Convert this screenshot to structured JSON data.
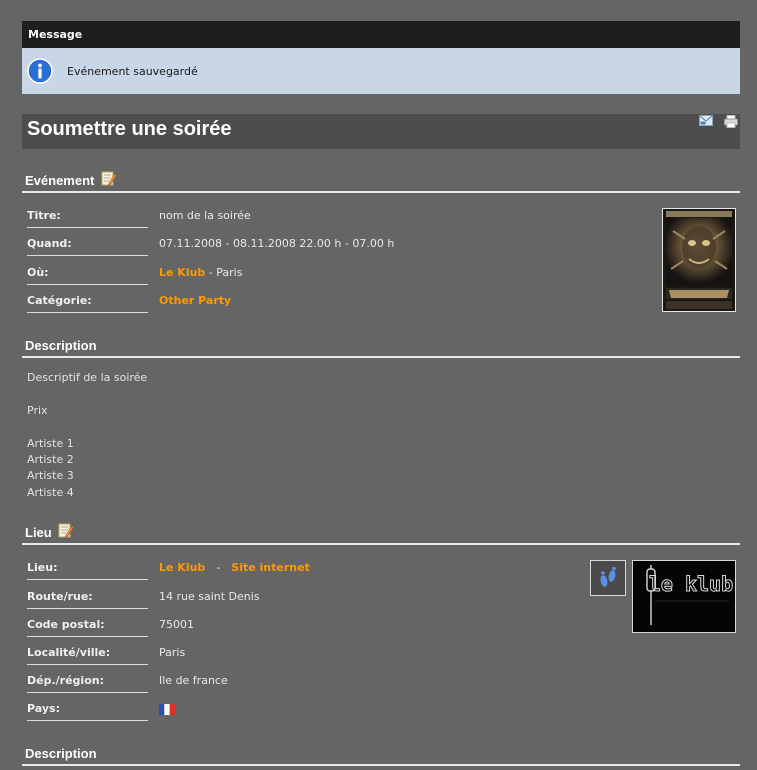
{
  "message": {
    "header": "Message",
    "text": "Evénement sauvegardé"
  },
  "page": {
    "title": "Soumettre une soirée"
  },
  "event": {
    "section": "Evénement",
    "fields": [
      {
        "label": "Titre:",
        "value": "nom de la soirée"
      },
      {
        "label": "Quand:",
        "value": "07.11.2008 - 08.11.2008 22.00 h - 07.00 h"
      },
      {
        "label": "Où:",
        "link": "Le Klub",
        "suffix": " - Paris"
      },
      {
        "label": "Catégorie:",
        "link": "Other Party"
      }
    ]
  },
  "description": {
    "section": "Description",
    "lines": [
      "Descriptif de la soirée",
      "",
      "Prix",
      "",
      "Artiste 1",
      "Artiste 2",
      "Artiste 3",
      "Artiste 4"
    ]
  },
  "venue": {
    "section": "Lieu",
    "fields": [
      {
        "label": "Lieu:",
        "link": "Le Klub",
        "separator": "-",
        "link2": "Site internet"
      },
      {
        "label": "Route/rue:",
        "value": "14 rue saint Denis"
      },
      {
        "label": "Code postal:",
        "value": "75001"
      },
      {
        "label": "Localité/ville:",
        "value": "Paris"
      },
      {
        "label": "Dép./région:",
        "value": "Ile de france"
      },
      {
        "label": "Pays:"
      }
    ],
    "logo_text": "le klub"
  },
  "description2": {
    "section": "Description"
  },
  "colors": {
    "background": "#656565",
    "accent": "#ff9900",
    "message_bg": "#c9d6e6"
  }
}
